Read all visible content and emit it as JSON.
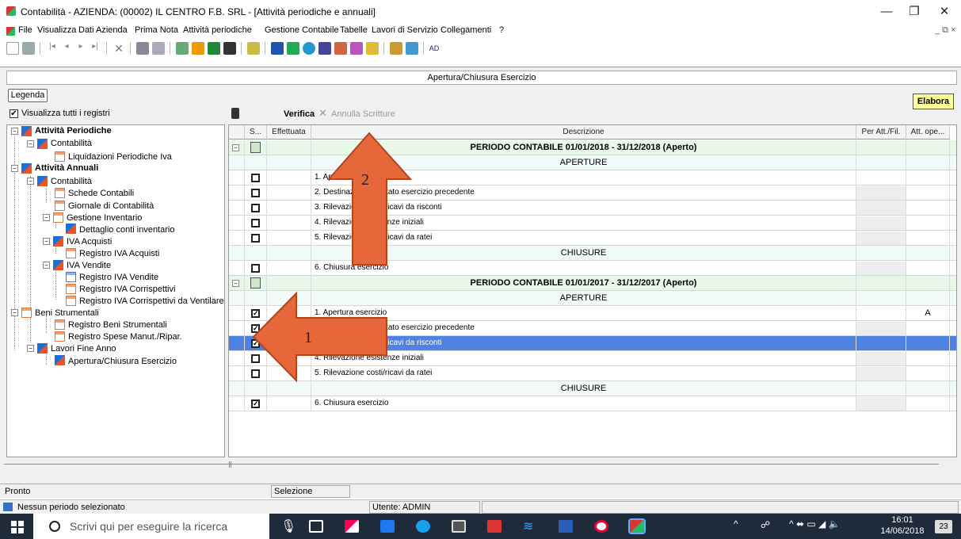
{
  "window": {
    "title": "Contabilità - AZIENDA: (00002) IL CENTRO F.B. SRL  - [Attività periodiche e annuali]",
    "controls": {
      "minimize": "—",
      "restore": "❐",
      "close": "✕"
    },
    "mdi_controls": "_ ⧉ ×"
  },
  "menu": [
    "File",
    "Visualizza",
    "Dati Azienda",
    "Prima Nota",
    "Attività periodiche",
    "Gestione Contabile",
    "Tabelle",
    "Lavori di Servizio",
    "Collegamenti",
    "?"
  ],
  "toolbar": {
    "last_label": "AD"
  },
  "panel": {
    "header": "Apertura/Chiusura Esercizio",
    "legenda_button": "Legenda",
    "show_all_label": "Visualizza tutti i registri",
    "show_all_checked": true
  },
  "actions": {
    "verifica": "Verifica",
    "annulla": "Annulla Scritture",
    "elabora": "Elabora"
  },
  "tree": [
    {
      "label": "Attività Periodiche",
      "bold": true
    },
    {
      "label": "Contabilità"
    },
    {
      "label": "Liquidazioni Periodiche Iva"
    },
    {
      "label": "Attività Annuali",
      "bold": true
    },
    {
      "label": "Contabilità"
    },
    {
      "label": "Schede Contabili"
    },
    {
      "label": "Giornale di Contabilità"
    },
    {
      "label": "Gestione Inventario"
    },
    {
      "label": "Dettaglio conti inventario"
    },
    {
      "label": "IVA Acquisti"
    },
    {
      "label": "Registro IVA Acquisti"
    },
    {
      "label": "IVA Vendite"
    },
    {
      "label": "Registro IVA Vendite"
    },
    {
      "label": "Registro IVA Corrispettivi"
    },
    {
      "label": "Registro IVA Corrispettivi da Ventilare"
    },
    {
      "label": "Beni Strumentali"
    },
    {
      "label": "Registro Beni Strumentali"
    },
    {
      "label": "Registro Spese Manut./Ripar."
    },
    {
      "label": "Lavori Fine Anno"
    },
    {
      "label": "Apertura/Chiusura Esercizio"
    }
  ],
  "grid": {
    "headers": [
      "S...",
      "Effettuata",
      "Descrizione",
      "Per Att./Fil.",
      "Att. ope..."
    ],
    "rows": [
      {
        "type": "group",
        "text": "PERIODO CONTABILE 01/01/2018 - 31/12/2018 (Aperto)"
      },
      {
        "type": "section",
        "text": "APERTURE"
      },
      {
        "type": "item",
        "checked": false,
        "text": "1. Apertura esercizio",
        "att": ""
      },
      {
        "type": "item",
        "checked": false,
        "text": "2. Destinazione risultato esercizio precedente",
        "att": ""
      },
      {
        "type": "item",
        "checked": false,
        "text": "3. Rilevazione costi/ricavi da risconti",
        "att": ""
      },
      {
        "type": "item",
        "checked": false,
        "text": "4. Rilevazione esistenze iniziali",
        "att": ""
      },
      {
        "type": "item",
        "checked": false,
        "text": "5. Rilevazione costi/ricavi da ratei",
        "att": ""
      },
      {
        "type": "section",
        "text": "CHIUSURE"
      },
      {
        "type": "item",
        "checked": false,
        "text": "6. Chiusura esercizio",
        "att": ""
      },
      {
        "type": "group",
        "text": "PERIODO CONTABILE 01/01/2017 - 31/12/2017 (Aperto)"
      },
      {
        "type": "section",
        "text": "APERTURE"
      },
      {
        "type": "item",
        "checked": true,
        "text": "1. Apertura esercizio",
        "att": "A"
      },
      {
        "type": "item",
        "checked": true,
        "text": "2. Destinazione risultato esercizio precedente",
        "att": ""
      },
      {
        "type": "item",
        "checked": true,
        "text": "3. Rilevazione costi/ricavi da risconti",
        "att": "",
        "selected": true
      },
      {
        "type": "item",
        "checked": false,
        "text": "4. Rilevazione esistenze iniziali",
        "att": ""
      },
      {
        "type": "item",
        "checked": false,
        "text": "5. Rilevazione costi/ricavi da ratei",
        "att": ""
      },
      {
        "type": "section",
        "text": "CHIUSURE"
      },
      {
        "type": "item",
        "checked": true,
        "text": "6. Chiusura esercizio",
        "att": ""
      }
    ]
  },
  "annotations": {
    "arrow1": "1",
    "arrow2": "2"
  },
  "status": {
    "pronto": "Pronto",
    "selezione": "Selezione",
    "periodo": "Nessun periodo selezionato",
    "utente": "Utente: ADMIN"
  },
  "taskbar": {
    "search_placeholder": "Scrivi qui per eseguire la ricerca",
    "time": "16:01",
    "date": "14/06/2018",
    "notifications": "23"
  }
}
